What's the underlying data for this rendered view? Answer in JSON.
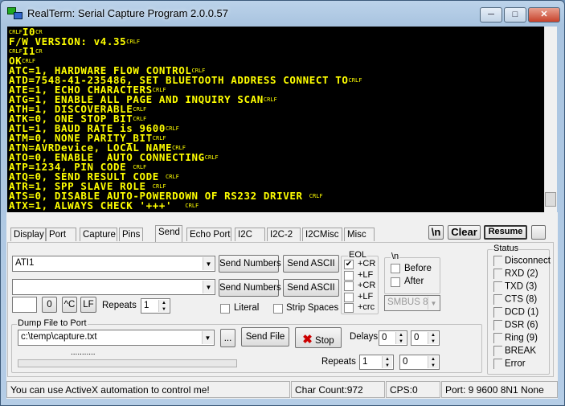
{
  "window": {
    "title": "RealTerm: Serial Capture Program 2.0.0.57",
    "minimize": "─",
    "maximize": "□",
    "close": "✕"
  },
  "terminal": {
    "text_color": "#ffff00",
    "background": "#000000",
    "lines": [
      {
        "pre": "CRLF",
        "text": "I0",
        "eol": "CR"
      },
      {
        "pre": "",
        "text": "F/W VERSION: v4.35",
        "eol": "CRLF"
      },
      {
        "pre": "CRLF",
        "text": "I1",
        "eol": "CR"
      },
      {
        "pre": "",
        "text": "OK",
        "eol": "CRLF"
      },
      {
        "pre": "",
        "text": "ATC=1, HARDWARE FLOW CONTROL",
        "eol": "CRLF"
      },
      {
        "pre": "",
        "text": "ATD=7548-41-235486, SET BLUETOOTH ADDRESS CONNECT TO",
        "eol": "CRLF"
      },
      {
        "pre": "",
        "text": "ATE=1, ECHO CHARACTERS",
        "eol": "CRLF"
      },
      {
        "pre": "",
        "text": "ATG=1, ENABLE ALL PAGE AND INQUIRY SCAN",
        "eol": "CRLF"
      },
      {
        "pre": "",
        "text": "ATH=1, DISCOVERABLE",
        "eol": "CRLF"
      },
      {
        "pre": "",
        "text": "ATK=0, ONE STOP BIT",
        "eol": "CRLF"
      },
      {
        "pre": "",
        "text": "ATL=1, BAUD RATE is 9600",
        "eol": "CRLF"
      },
      {
        "pre": "",
        "text": "ATM=0, NONE PARITY_BIT",
        "eol": "CRLF"
      },
      {
        "pre": "",
        "text": "ATN=AVRDevice, LOCAL NAME",
        "eol": "CRLF"
      },
      {
        "pre": "",
        "text": "ATO=0, ENABLE  AUTO CONNECTING",
        "eol": "CRLF"
      },
      {
        "pre": "",
        "text": "ATP=1234, PIN CODE ",
        "eol": "CRLF"
      },
      {
        "pre": "",
        "text": "ATQ=0, SEND RESULT CODE ",
        "eol": "CRLF"
      },
      {
        "pre": "",
        "text": "ATR=1, SPP SLAVE ROLE ",
        "eol": "CRLF"
      },
      {
        "pre": "",
        "text": "ATS=0, DISABLE AUTO-POWERDOWN OF RS232 DRIVER ",
        "eol": "CRLF"
      },
      {
        "pre": "",
        "text": "ATX=1, ALWAYS CHECK '+++'  ",
        "eol": "CRLF"
      }
    ]
  },
  "tabs": [
    {
      "label": "Display"
    },
    {
      "label": "Port"
    },
    {
      "label": "Capture"
    },
    {
      "label": "Pins"
    },
    {
      "label": "Send",
      "selected": true
    },
    {
      "label": "Echo Port"
    },
    {
      "label": "I2C"
    },
    {
      "label": "I2C-2"
    },
    {
      "label": "I2CMisc"
    },
    {
      "label": "Misc"
    }
  ],
  "toolbar": {
    "newline": "\\n",
    "clear": "Clear",
    "resume": "Resume"
  },
  "send": {
    "row1": {
      "value": "ATI1",
      "send_numbers": "Send Numbers",
      "send_ascii": "Send ASCII"
    },
    "row2": {
      "value": "",
      "send_numbers": "Send Numbers",
      "send_ascii": "Send ASCII"
    },
    "char_value": "",
    "zero": "0",
    "ctrl_c": "^C",
    "lf": "LF",
    "repeats_label": "Repeats",
    "repeats": "1",
    "literal": "Literal",
    "strip_spaces": "Strip Spaces",
    "eol": {
      "title": "EOL",
      "items": [
        {
          "label": "+CR",
          "checked": true
        },
        {
          "label": "+LF",
          "checked": false
        },
        {
          "label": "+CR",
          "checked": false
        },
        {
          "label": "+LF",
          "checked": false
        },
        {
          "label": "+crc",
          "checked": false
        }
      ]
    },
    "newline_group": {
      "title": "\\n",
      "before": "Before",
      "after": "After"
    },
    "smbus": "SMBUS 8"
  },
  "dump": {
    "title": "Dump File to Port",
    "file": "c:\\temp\\capture.txt",
    "browse": "...",
    "send_file": "Send File",
    "stop": "Stop",
    "delays_label": "Delays",
    "delay1": "0",
    "delay2": "0",
    "progress_text": "...........",
    "progress": 0,
    "repeats_label": "Repeats",
    "repeats1": "1",
    "repeats2": "0"
  },
  "status_group": {
    "title": "Status",
    "items": [
      "Disconnect",
      "RXD (2)",
      "TXD (3)",
      "CTS (8)",
      "DCD (1)",
      "DSR (6)",
      "Ring (9)",
      "BREAK",
      "Error"
    ]
  },
  "statusbar": {
    "message": "You can use ActiveX automation to control me!",
    "char_count": "Char Count:972",
    "cps": "CPS:0",
    "port": "Port: 9 9600 8N1 None"
  }
}
